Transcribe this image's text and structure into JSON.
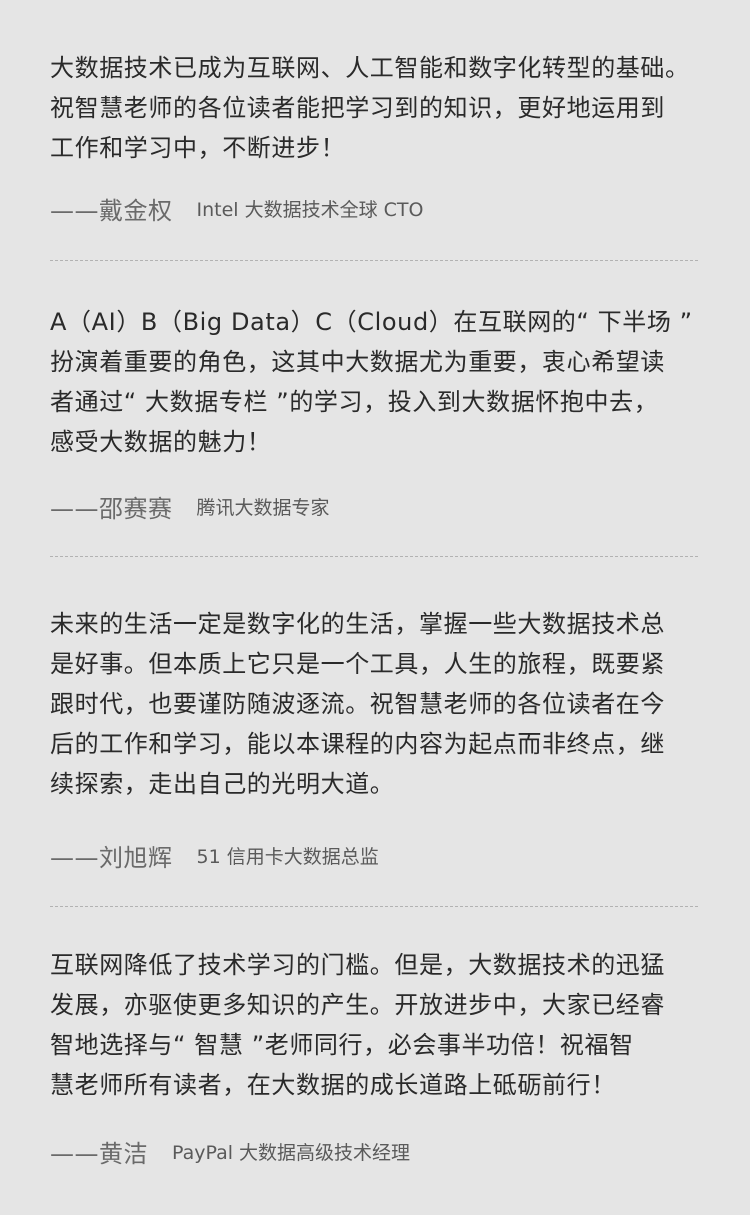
{
  "quotes": [
    {
      "lines": [
        "大数据技术已成为互联网、人工智能和数字化转型的基础。",
        "祝智慧老师的各位读者能把学习到的知识，更好地运用到",
        "工作和学习中，不断进步！"
      ],
      "author": "——戴金权",
      "title": "Intel 大数据技术全球 CTO"
    },
    {
      "lines": [
        "A（AI）B（Big Data）C（Cloud）在互联网的“ 下半场 ”",
        "扮演着重要的角色，这其中大数据尤为重要，衷心希望读",
        "者通过“ 大数据专栏 ”的学习，投入到大数据怀抱中去，",
        "感受大数据的魅力！"
      ],
      "author": "——邵赛赛",
      "title": "腾讯大数据专家"
    },
    {
      "lines": [
        "未来的生活一定是数字化的生活，掌握一些大数据技术总",
        "是好事。但本质上它只是一个工具，人生的旅程，既要紧",
        "跟时代，也要谨防随波逐流。祝智慧老师的各位读者在今",
        "后的工作和学习，能以本课程的内容为起点而非终点，继",
        "续探索，走出自己的光明大道。"
      ],
      "author": "——刘旭辉",
      "title": "51 信用卡大数据总监"
    },
    {
      "lines": [
        "互联网降低了技术学习的门槛。但是，大数据技术的迅猛",
        "发展，亦驱使更多知识的产生。开放进步中，大家已经睿",
        "智地选择与“ 智慧 ”老师同行，必会事半功倍！祝福智",
        "慧老师所有读者，在大数据的成长道路上砥砺前行！"
      ],
      "author": "——黄洁",
      "title": "PayPal 大数据高级技术经理"
    }
  ]
}
